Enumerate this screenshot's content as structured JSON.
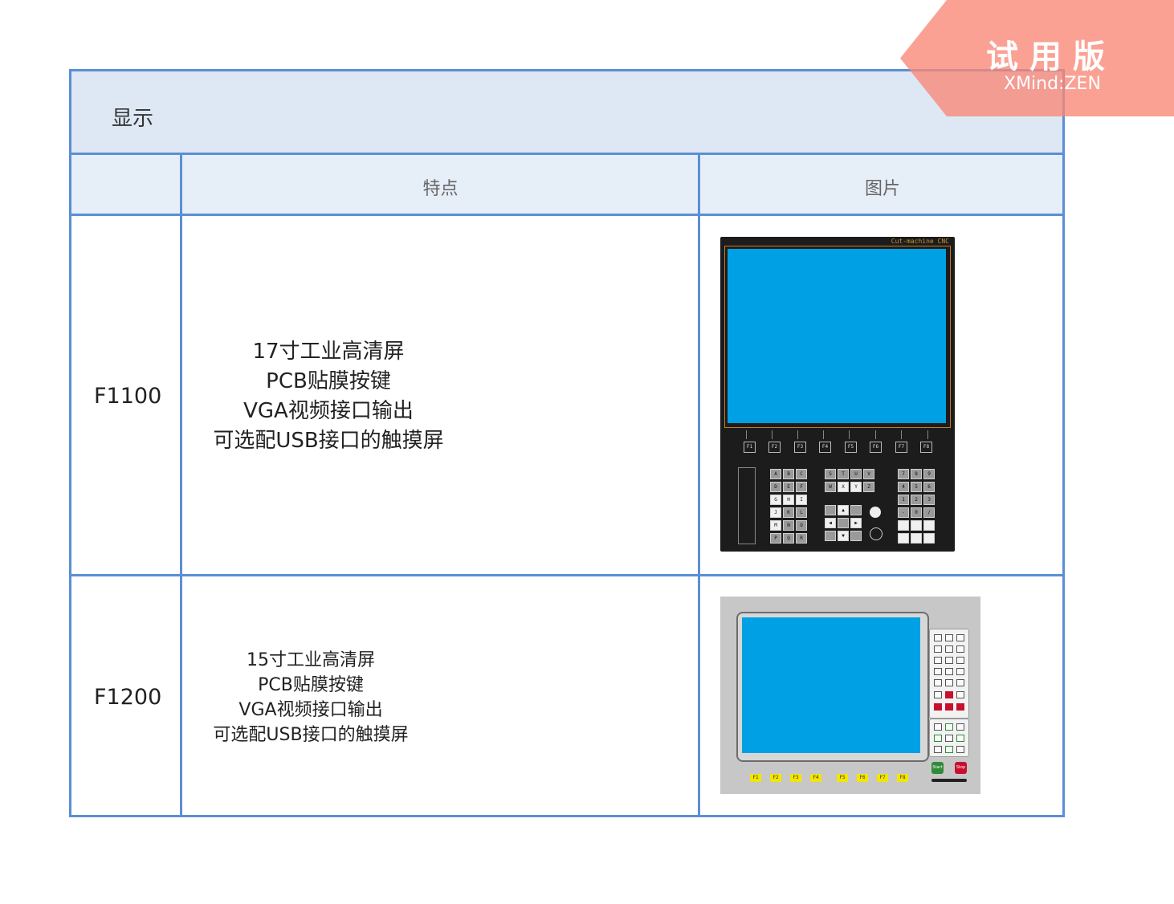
{
  "sheet": {
    "title": "显示",
    "headers": {
      "blank": "",
      "features": "特点",
      "image": "图片"
    }
  },
  "rows": [
    {
      "model": "F1100",
      "features": [
        "17寸工业高清屏",
        "PCB贴膜按键",
        "VGA视频接口输出",
        "可选配USB接口的触摸屏"
      ],
      "panel": {
        "brand": "Cut-machine CNC",
        "fkeys": [
          "F1",
          "F2",
          "F3",
          "F4",
          "F5",
          "F6",
          "F7",
          "F8"
        ]
      }
    },
    {
      "model": "F1200",
      "features": [
        "15寸工业高清屏",
        "PCB贴膜按键",
        "VGA视频接口输出",
        "可选配USB接口的触摸屏"
      ],
      "panel": {
        "fkeys": [
          "F1",
          "F2",
          "F3",
          "F4",
          "F5",
          "F6",
          "F7",
          "F8"
        ],
        "start_label": "Start",
        "stop_label": "Stop"
      }
    }
  ],
  "watermark": {
    "title": "试用版",
    "subtitle": "XMind:ZEN"
  },
  "colors": {
    "border": "#5b8fd6",
    "title_bg": "#dde8f4",
    "screen": "#00a0e4",
    "watermark": "#f88676"
  }
}
